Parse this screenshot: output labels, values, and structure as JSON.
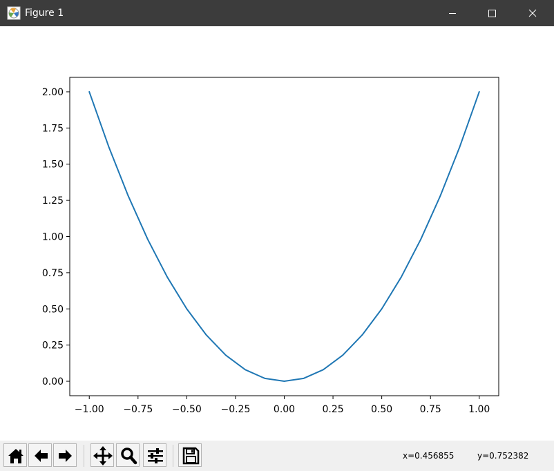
{
  "window": {
    "title": "Figure 1",
    "title_bar_color": "#3c3c3c"
  },
  "toolbar": {
    "buttons": [
      {
        "name": "home",
        "icon": "home-icon"
      },
      {
        "name": "back",
        "icon": "arrow-left-icon"
      },
      {
        "name": "forward",
        "icon": "arrow-right-icon"
      },
      {
        "name": "pan",
        "icon": "move-arrows-icon"
      },
      {
        "name": "zoom",
        "icon": "magnifier-icon"
      },
      {
        "name": "configure-subplots",
        "icon": "sliders-icon"
      },
      {
        "name": "save",
        "icon": "floppy-disk-icon"
      }
    ],
    "x_readout": "x=0.456855",
    "y_readout": "y=0.752382"
  },
  "chart_data": {
    "type": "line",
    "title": "",
    "xlabel": "",
    "ylabel": "",
    "xlim": [
      -1.1,
      1.1
    ],
    "ylim": [
      -0.1,
      2.1
    ],
    "x_ticks": [
      -1.0,
      -0.75,
      -0.5,
      -0.25,
      0.0,
      0.25,
      0.5,
      0.75,
      1.0
    ],
    "x_tick_labels": [
      "−1.00",
      "−0.75",
      "−0.50",
      "−0.25",
      "0.00",
      "0.25",
      "0.50",
      "0.75",
      "1.00"
    ],
    "y_ticks": [
      0.0,
      0.25,
      0.5,
      0.75,
      1.0,
      1.25,
      1.5,
      1.75,
      2.0
    ],
    "y_tick_labels": [
      "0.00",
      "0.25",
      "0.50",
      "0.75",
      "1.00",
      "1.25",
      "1.50",
      "1.75",
      "2.00"
    ],
    "grid": false,
    "legend": "none",
    "series": [
      {
        "color": "#1f77b4",
        "x": [
          -1.0,
          -0.9,
          -0.8,
          -0.7,
          -0.6,
          -0.5,
          -0.4,
          -0.3,
          -0.2,
          -0.1,
          0.0,
          0.1,
          0.2,
          0.3,
          0.4,
          0.5,
          0.6,
          0.7,
          0.8,
          0.9,
          1.0
        ],
        "y": [
          2.0,
          1.62,
          1.28,
          0.98,
          0.72,
          0.5,
          0.32,
          0.18,
          0.08,
          0.02,
          0.0,
          0.02,
          0.08,
          0.18,
          0.32,
          0.5,
          0.72,
          0.98,
          1.28,
          1.62,
          2.0
        ]
      }
    ]
  }
}
